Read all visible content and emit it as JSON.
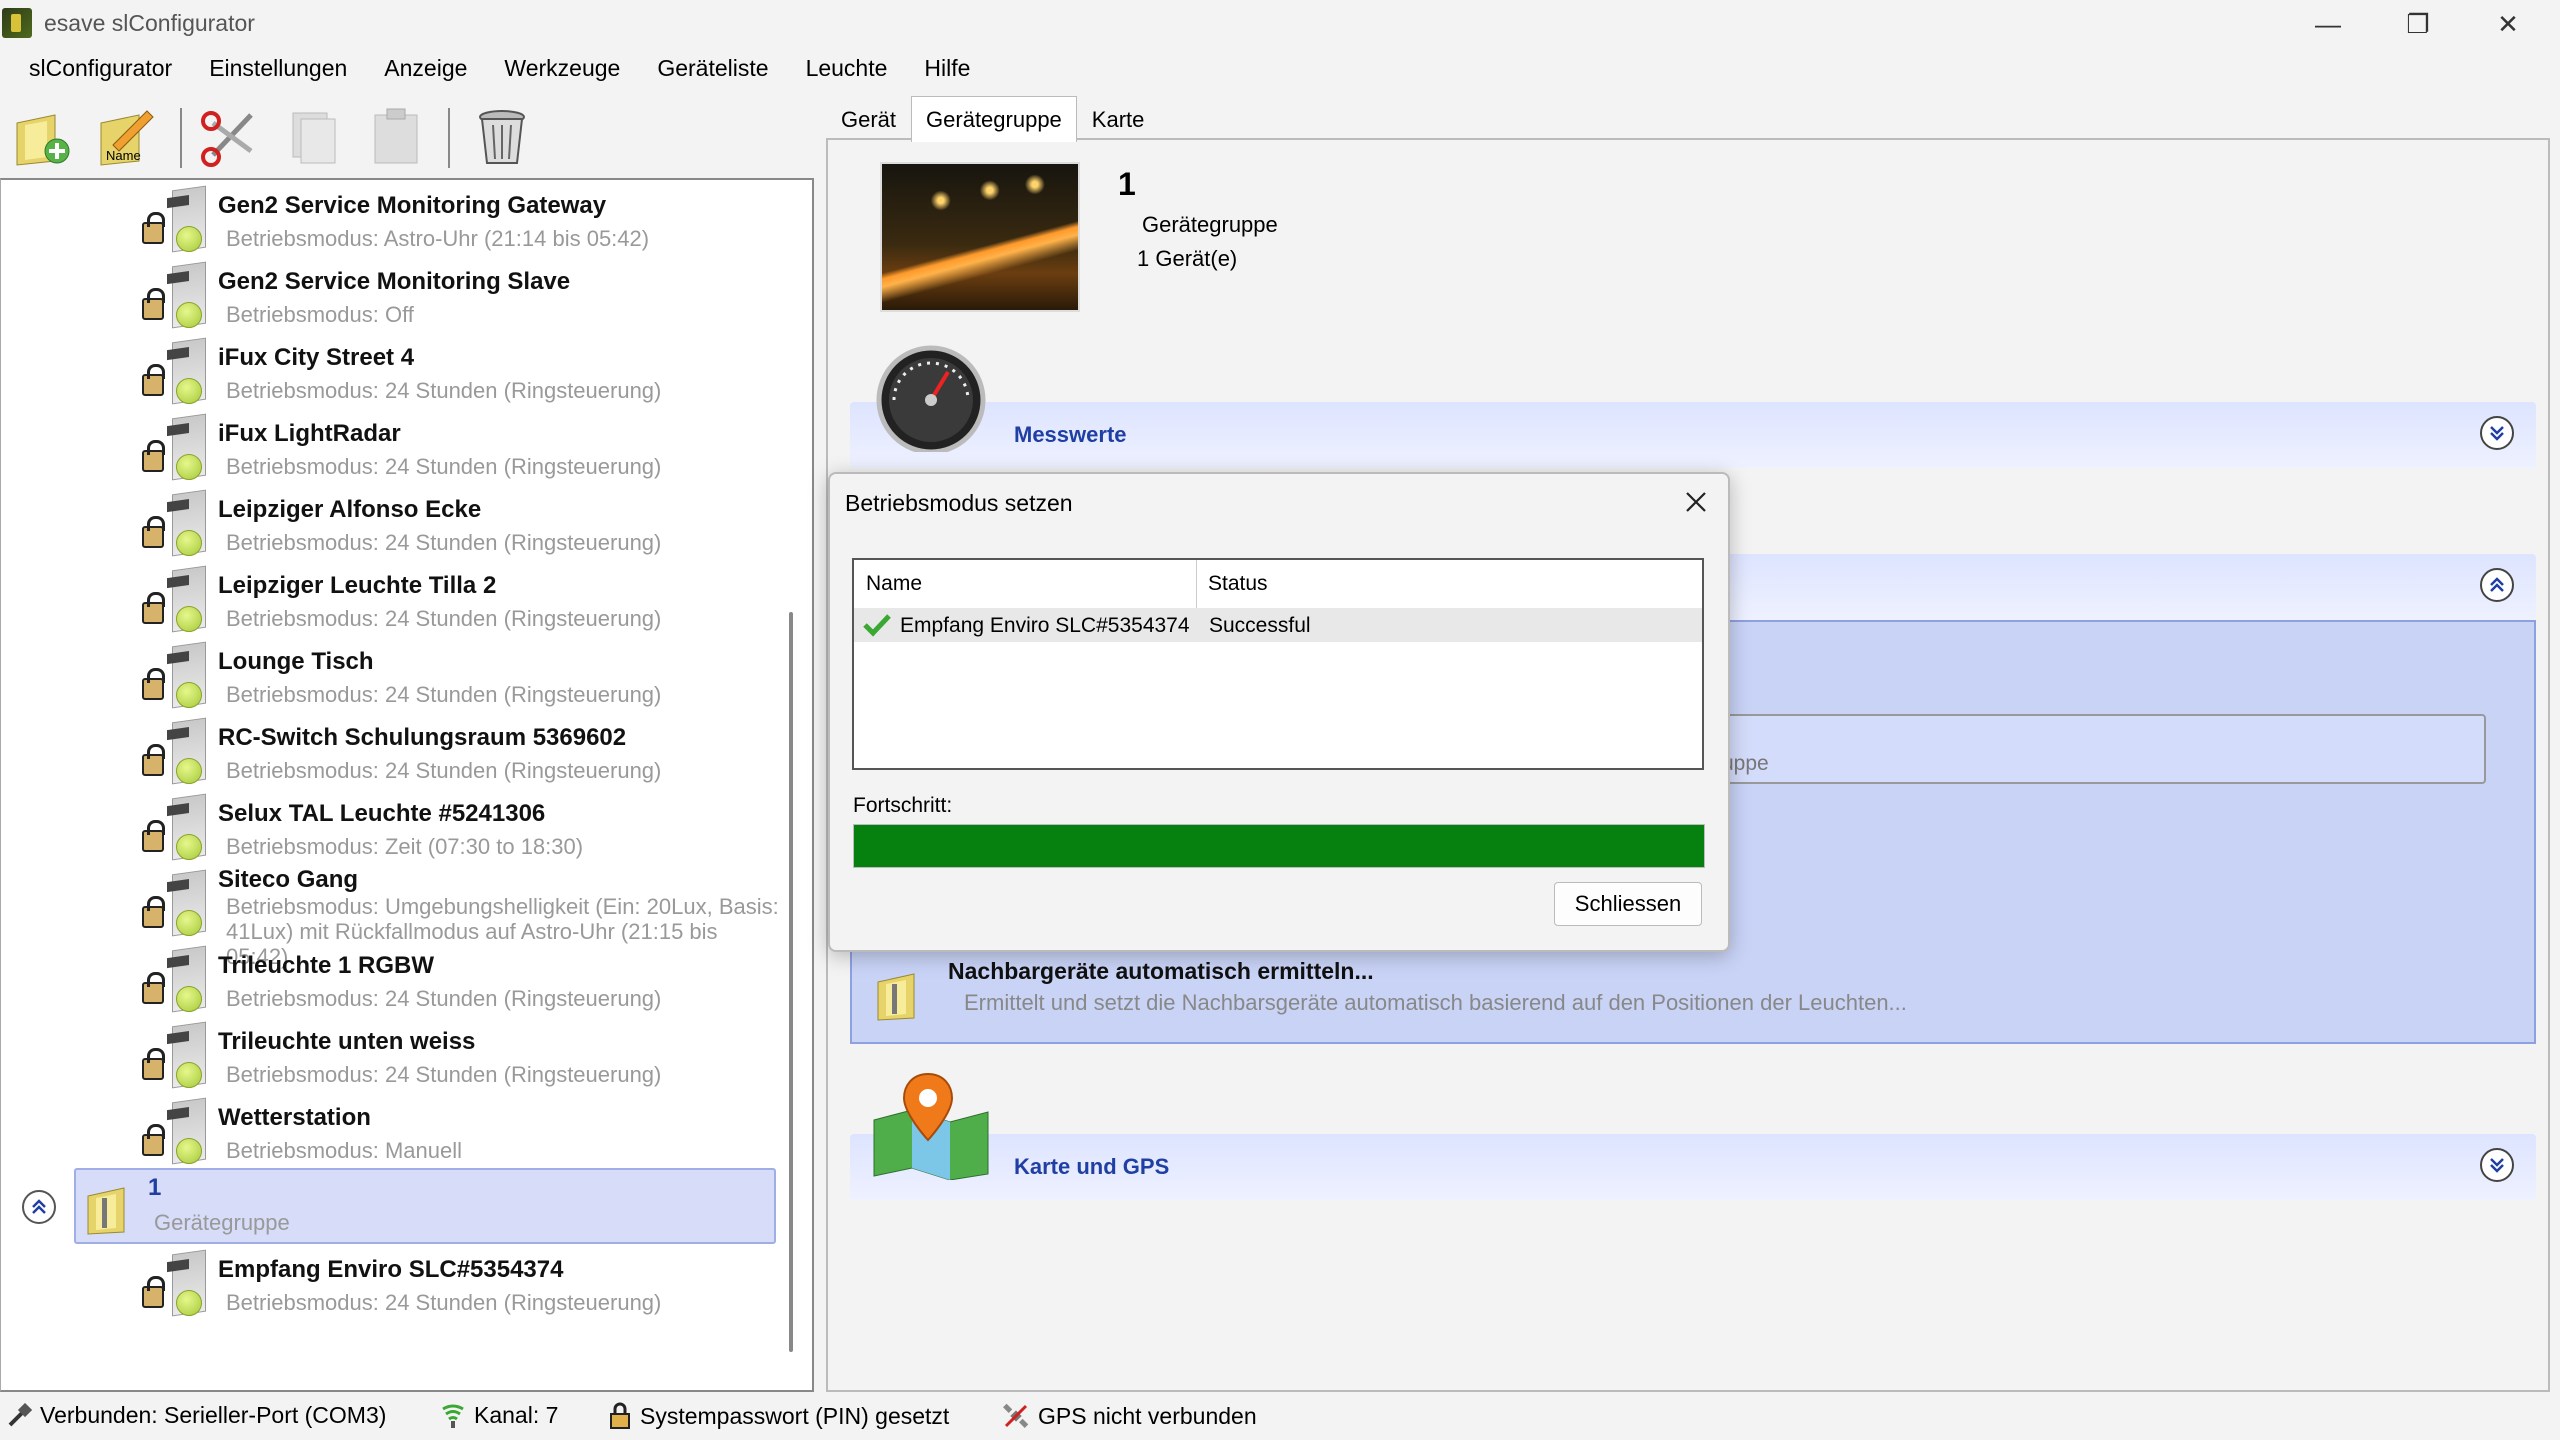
{
  "window": {
    "title": "esave slConfigurator",
    "minimize_glyph": "—",
    "restore_glyph": "❐",
    "close_glyph": "✕"
  },
  "menu": [
    "slConfigurator",
    "Einstellungen",
    "Anzeige",
    "Werkzeuge",
    "Geräteliste",
    "Leuchte",
    "Hilfe"
  ],
  "toolbar": {
    "icons": [
      "add-lamp-icon",
      "rename-icon",
      "cut-icon",
      "copy-icon",
      "paste-icon",
      "trash-icon"
    ],
    "rename_badge": "Name"
  },
  "tree": {
    "nodes": [
      {
        "title": "Gen2 Service Monitoring Gateway",
        "sub": "Betriebsmodus: Astro-Uhr (21:14 bis 05:42)"
      },
      {
        "title": "Gen2 Service Monitoring Slave",
        "sub": "Betriebsmodus: Off"
      },
      {
        "title": "iFux City Street 4",
        "sub": "Betriebsmodus: 24 Stunden (Ringsteuerung)"
      },
      {
        "title": "iFux LightRadar",
        "sub": "Betriebsmodus: 24 Stunden (Ringsteuerung)"
      },
      {
        "title": "Leipziger Alfonso Ecke",
        "sub": "Betriebsmodus: 24 Stunden (Ringsteuerung)"
      },
      {
        "title": "Leipziger Leuchte Tilla 2",
        "sub": "Betriebsmodus: 24 Stunden (Ringsteuerung)"
      },
      {
        "title": "Lounge Tisch",
        "sub": "Betriebsmodus: 24 Stunden (Ringsteuerung)"
      },
      {
        "title": "RC-Switch Schulungsraum 5369602",
        "sub": "Betriebsmodus: 24 Stunden (Ringsteuerung)"
      },
      {
        "title": "Selux TAL Leuchte #5241306",
        "sub": "Betriebsmodus: Zeit (07:30 to 18:30)"
      },
      {
        "title": "Siteco Gang",
        "sub": "Betriebsmodus: Umgebungshelligkeit (Ein: 20Lux, Basis: 41Lux) mit Rückfallmodus auf Astro-Uhr (21:15 bis 05:42)"
      },
      {
        "title": "Trileuchte 1 RGBW",
        "sub": "Betriebsmodus: 24 Stunden (Ringsteuerung)"
      },
      {
        "title": "Trileuchte unten weiss",
        "sub": "Betriebsmodus: 24 Stunden (Ringsteuerung)"
      },
      {
        "title": "Wetterstation",
        "sub": "Betriebsmodus: Manuell"
      }
    ],
    "group": {
      "title": "1",
      "sub": "Gerätegruppe"
    },
    "child": {
      "title": "Empfang Enviro SLC#5354374",
      "sub": "Betriebsmodus: 24 Stunden (Ringsteuerung)"
    }
  },
  "tabs": [
    "Gerät",
    "Gerätegruppe",
    "Karte"
  ],
  "detail": {
    "number": "1",
    "type": "Gerätegruppe",
    "count": "1 Gerät(e)",
    "sections": {
      "measurements": "Messwerte",
      "map_gps": "Karte und GPS"
    },
    "partial_field_text": "uppe",
    "auto_title": "Nachbargeräte automatisch ermitteln...",
    "auto_desc": "Ermittelt und setzt die Nachbarsgeräte automatisch basierend auf den Positionen der Leuchten..."
  },
  "dialog": {
    "title": "Betriebsmodus setzen",
    "col_name": "Name",
    "col_status": "Status",
    "rows": [
      {
        "name": "Empfang Enviro SLC#5354374",
        "status": "Successful"
      }
    ],
    "progress_label": "Fortschritt:",
    "progress_value": 1.0,
    "close_button": "Schliessen"
  },
  "status": {
    "connection": "Verbunden: Serieller-Port (COM3)",
    "channel": "Kanal: 7",
    "pin": "Systempasswort (PIN) gesetzt",
    "gps": "GPS nicht verbunden"
  },
  "colors": {
    "accent": "#1f3fa3",
    "selection": "#d7dcf8",
    "progress": "#06800e",
    "success": "#3aa832"
  }
}
